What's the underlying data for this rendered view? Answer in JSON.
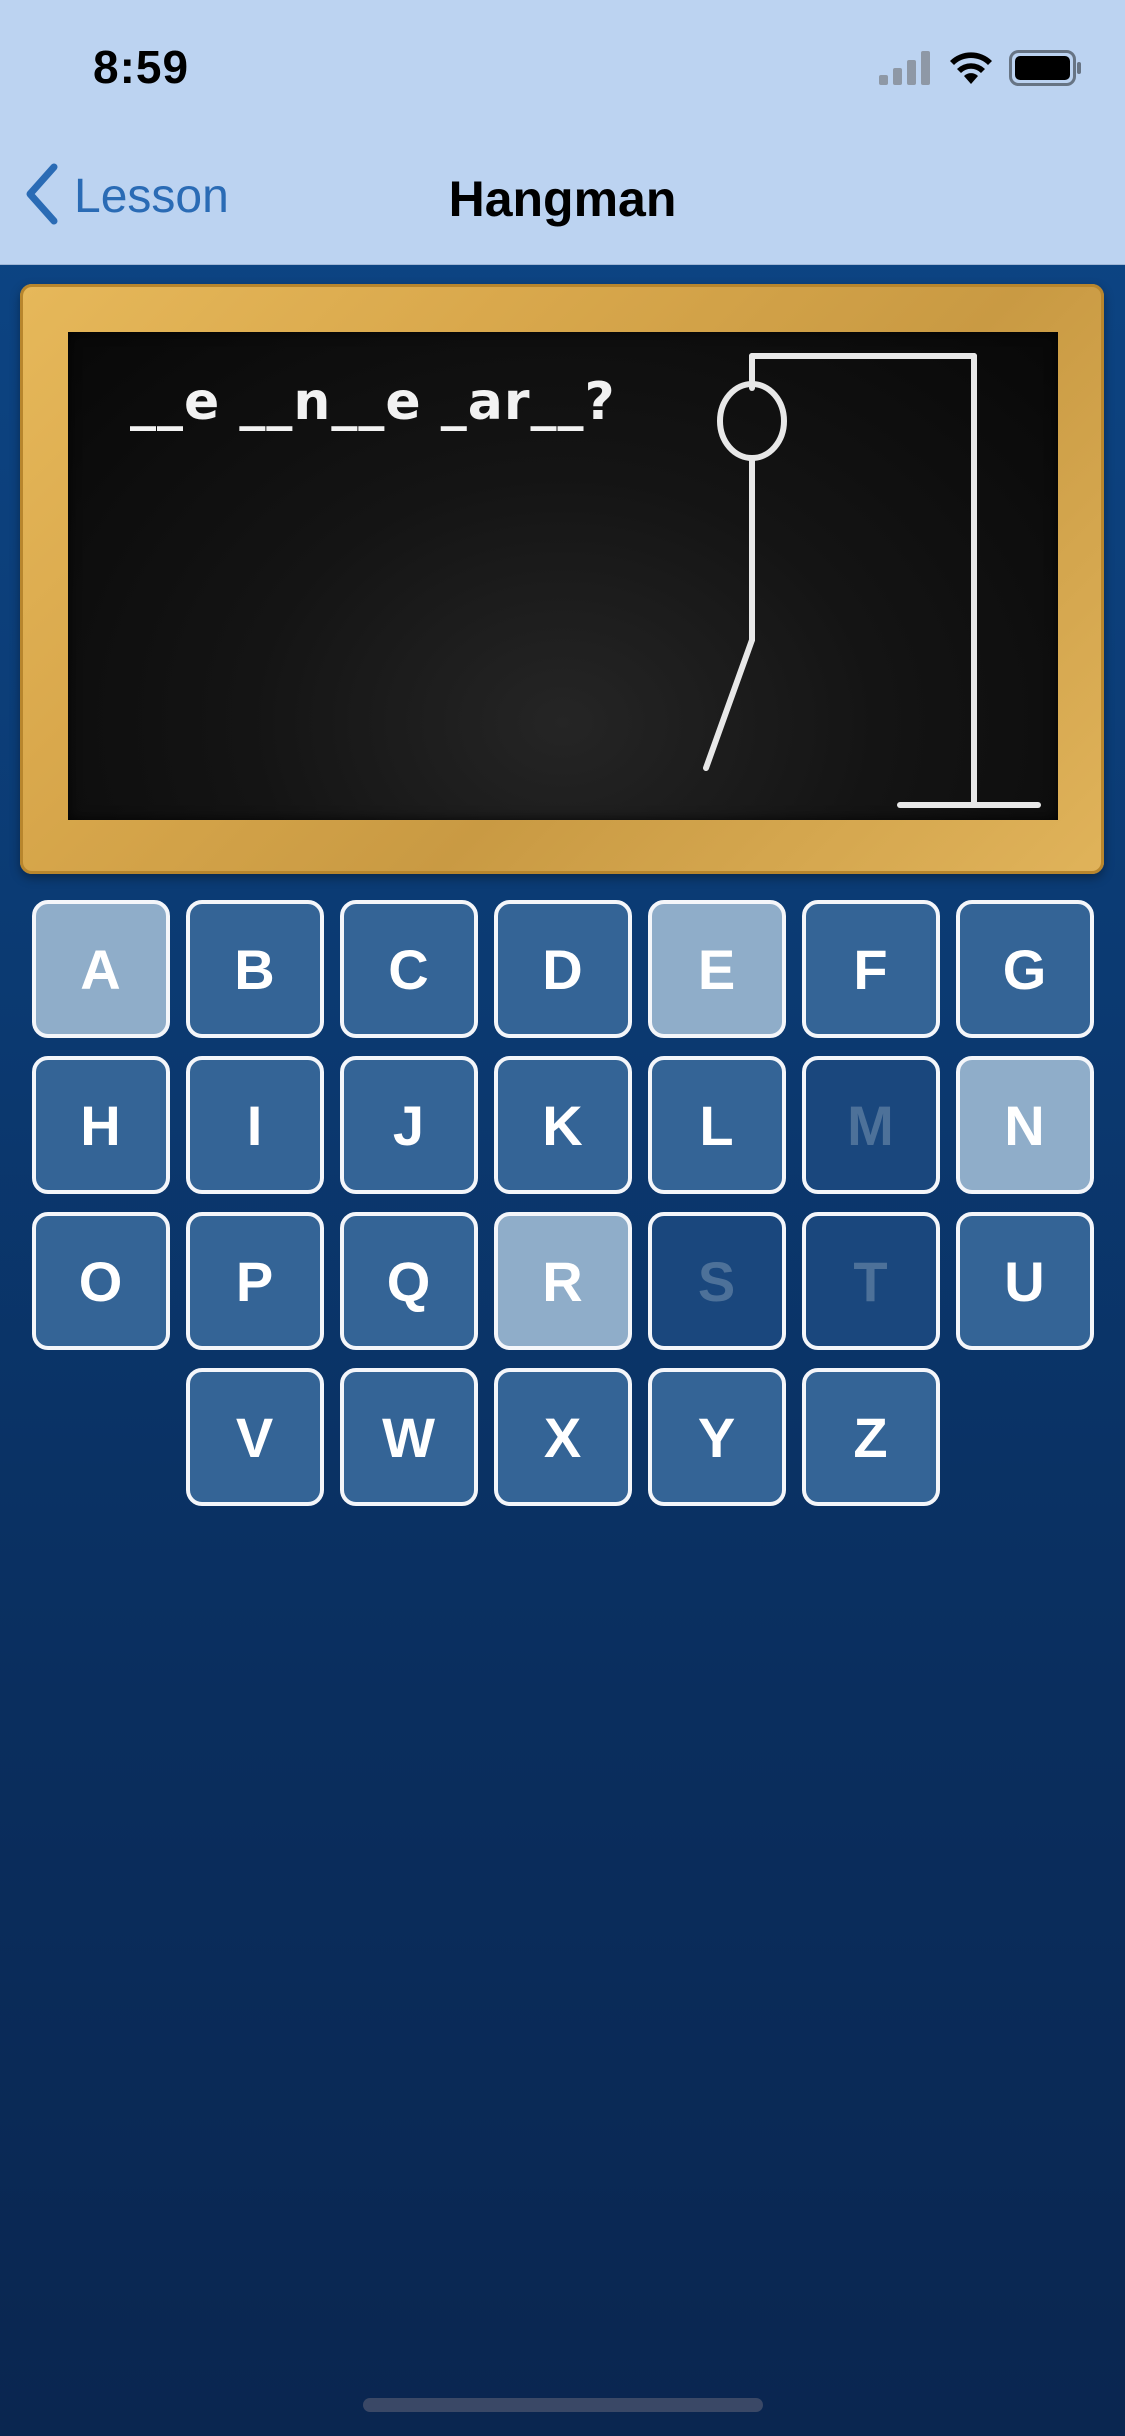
{
  "status_bar": {
    "time": "8:59",
    "icons": [
      "cellular-signal-icon",
      "wifi-icon",
      "battery-icon"
    ]
  },
  "nav": {
    "back_label": "Lesson",
    "title": "Hangman"
  },
  "puzzle": {
    "text": "__e __n__e _ar__?"
  },
  "hangman": {
    "parts_drawn": [
      "gallows",
      "head",
      "body",
      "left-leg"
    ],
    "wrong_guesses": 3
  },
  "keyboard": {
    "rows": [
      [
        {
          "letter": "A",
          "state": "correct"
        },
        {
          "letter": "B",
          "state": "normal"
        },
        {
          "letter": "C",
          "state": "normal"
        },
        {
          "letter": "D",
          "state": "normal"
        },
        {
          "letter": "E",
          "state": "correct"
        },
        {
          "letter": "F",
          "state": "normal"
        },
        {
          "letter": "G",
          "state": "normal"
        }
      ],
      [
        {
          "letter": "H",
          "state": "normal"
        },
        {
          "letter": "I",
          "state": "normal"
        },
        {
          "letter": "J",
          "state": "normal"
        },
        {
          "letter": "K",
          "state": "normal"
        },
        {
          "letter": "L",
          "state": "normal"
        },
        {
          "letter": "M",
          "state": "wrong"
        },
        {
          "letter": "N",
          "state": "correct"
        }
      ],
      [
        {
          "letter": "O",
          "state": "normal"
        },
        {
          "letter": "P",
          "state": "normal"
        },
        {
          "letter": "Q",
          "state": "normal"
        },
        {
          "letter": "R",
          "state": "correct"
        },
        {
          "letter": "S",
          "state": "wrong"
        },
        {
          "letter": "T",
          "state": "wrong"
        },
        {
          "letter": "U",
          "state": "normal"
        }
      ],
      [
        {
          "letter": "V",
          "state": "normal"
        },
        {
          "letter": "W",
          "state": "normal"
        },
        {
          "letter": "X",
          "state": "normal"
        },
        {
          "letter": "Y",
          "state": "normal"
        },
        {
          "letter": "Z",
          "state": "normal"
        }
      ]
    ]
  },
  "colors": {
    "nav_background": "#bcd3f1",
    "accent": "#2a6bb5",
    "key_normal": "#346496",
    "key_correct": "#8fadc9",
    "key_wrong": "#1a477d"
  }
}
